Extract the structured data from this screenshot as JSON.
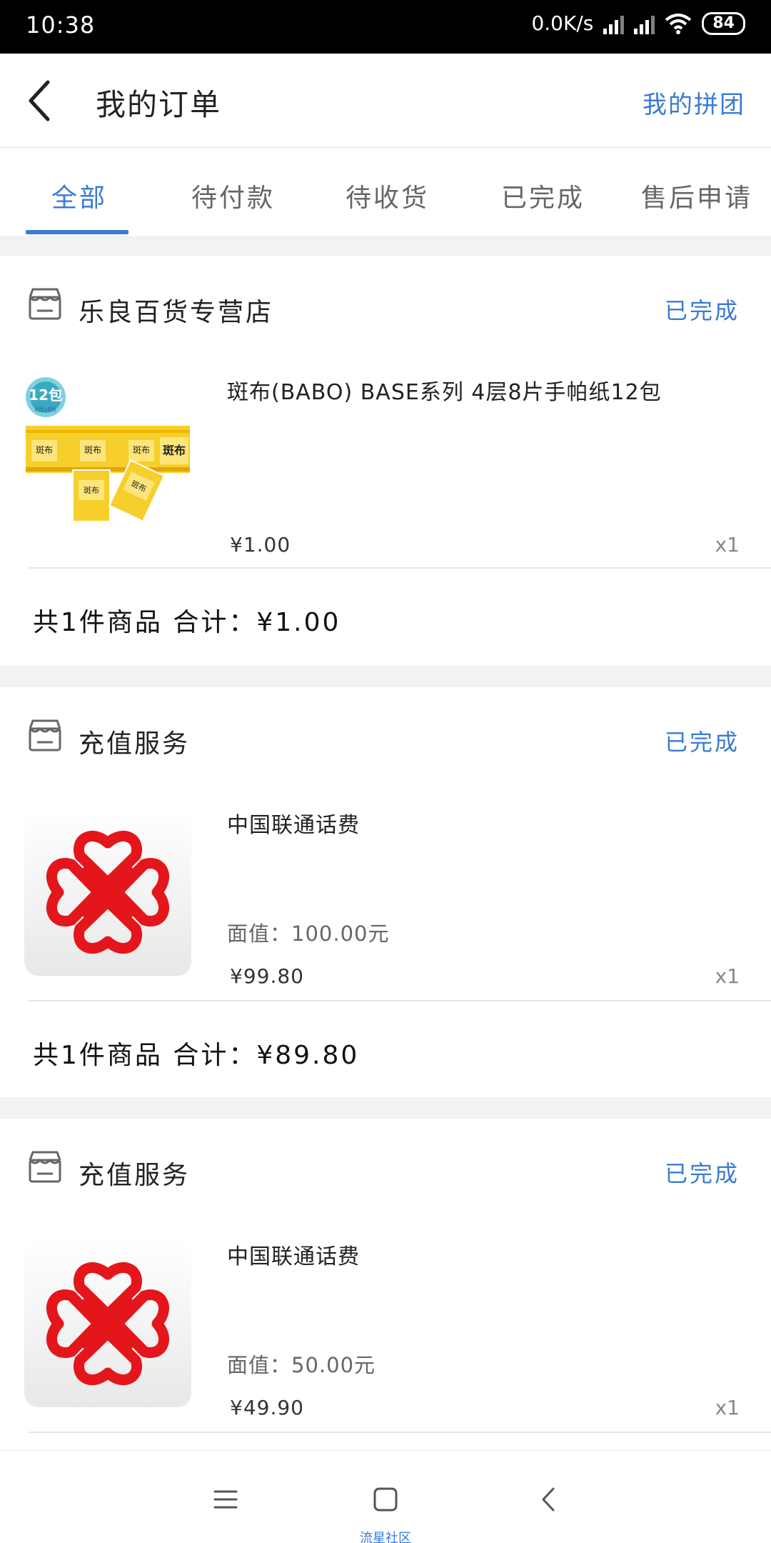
{
  "status_bar": {
    "time": "10:38",
    "speed": "0.0K/s",
    "battery": "84"
  },
  "header": {
    "title": "我的订单",
    "right_link": "我的拼团"
  },
  "tabs": [
    "全部",
    "待付款",
    "待收货",
    "已完成",
    "售后申请"
  ],
  "orders": [
    {
      "shop": "乐良百货专营店",
      "status": "已完成",
      "product": "斑布(BABO) BASE系列 4层8片手帕纸12包",
      "spec": "",
      "price": "¥1.00",
      "qty": "x1",
      "summary": "共1件商品  合计：¥1.00",
      "thumb_text": {
        "badge": "12包",
        "badge_sub": "4层x8片",
        "brand": "斑布"
      }
    },
    {
      "shop": "充值服务",
      "status": "已完成",
      "product": "中国联通话费",
      "spec": "面值：100.00元",
      "price": "¥99.80",
      "qty": "x1",
      "summary": "共1件商品  合计：¥89.80"
    },
    {
      "shop": "充值服务",
      "status": "已完成",
      "product": "中国联通话费",
      "spec": "面值：50.00元",
      "price": "¥49.90",
      "qty": "x1"
    }
  ],
  "nav": {
    "caption": "流星社区"
  },
  "colors": {
    "accent": "#3a7bd5",
    "unicom_red": "#e4161b"
  }
}
